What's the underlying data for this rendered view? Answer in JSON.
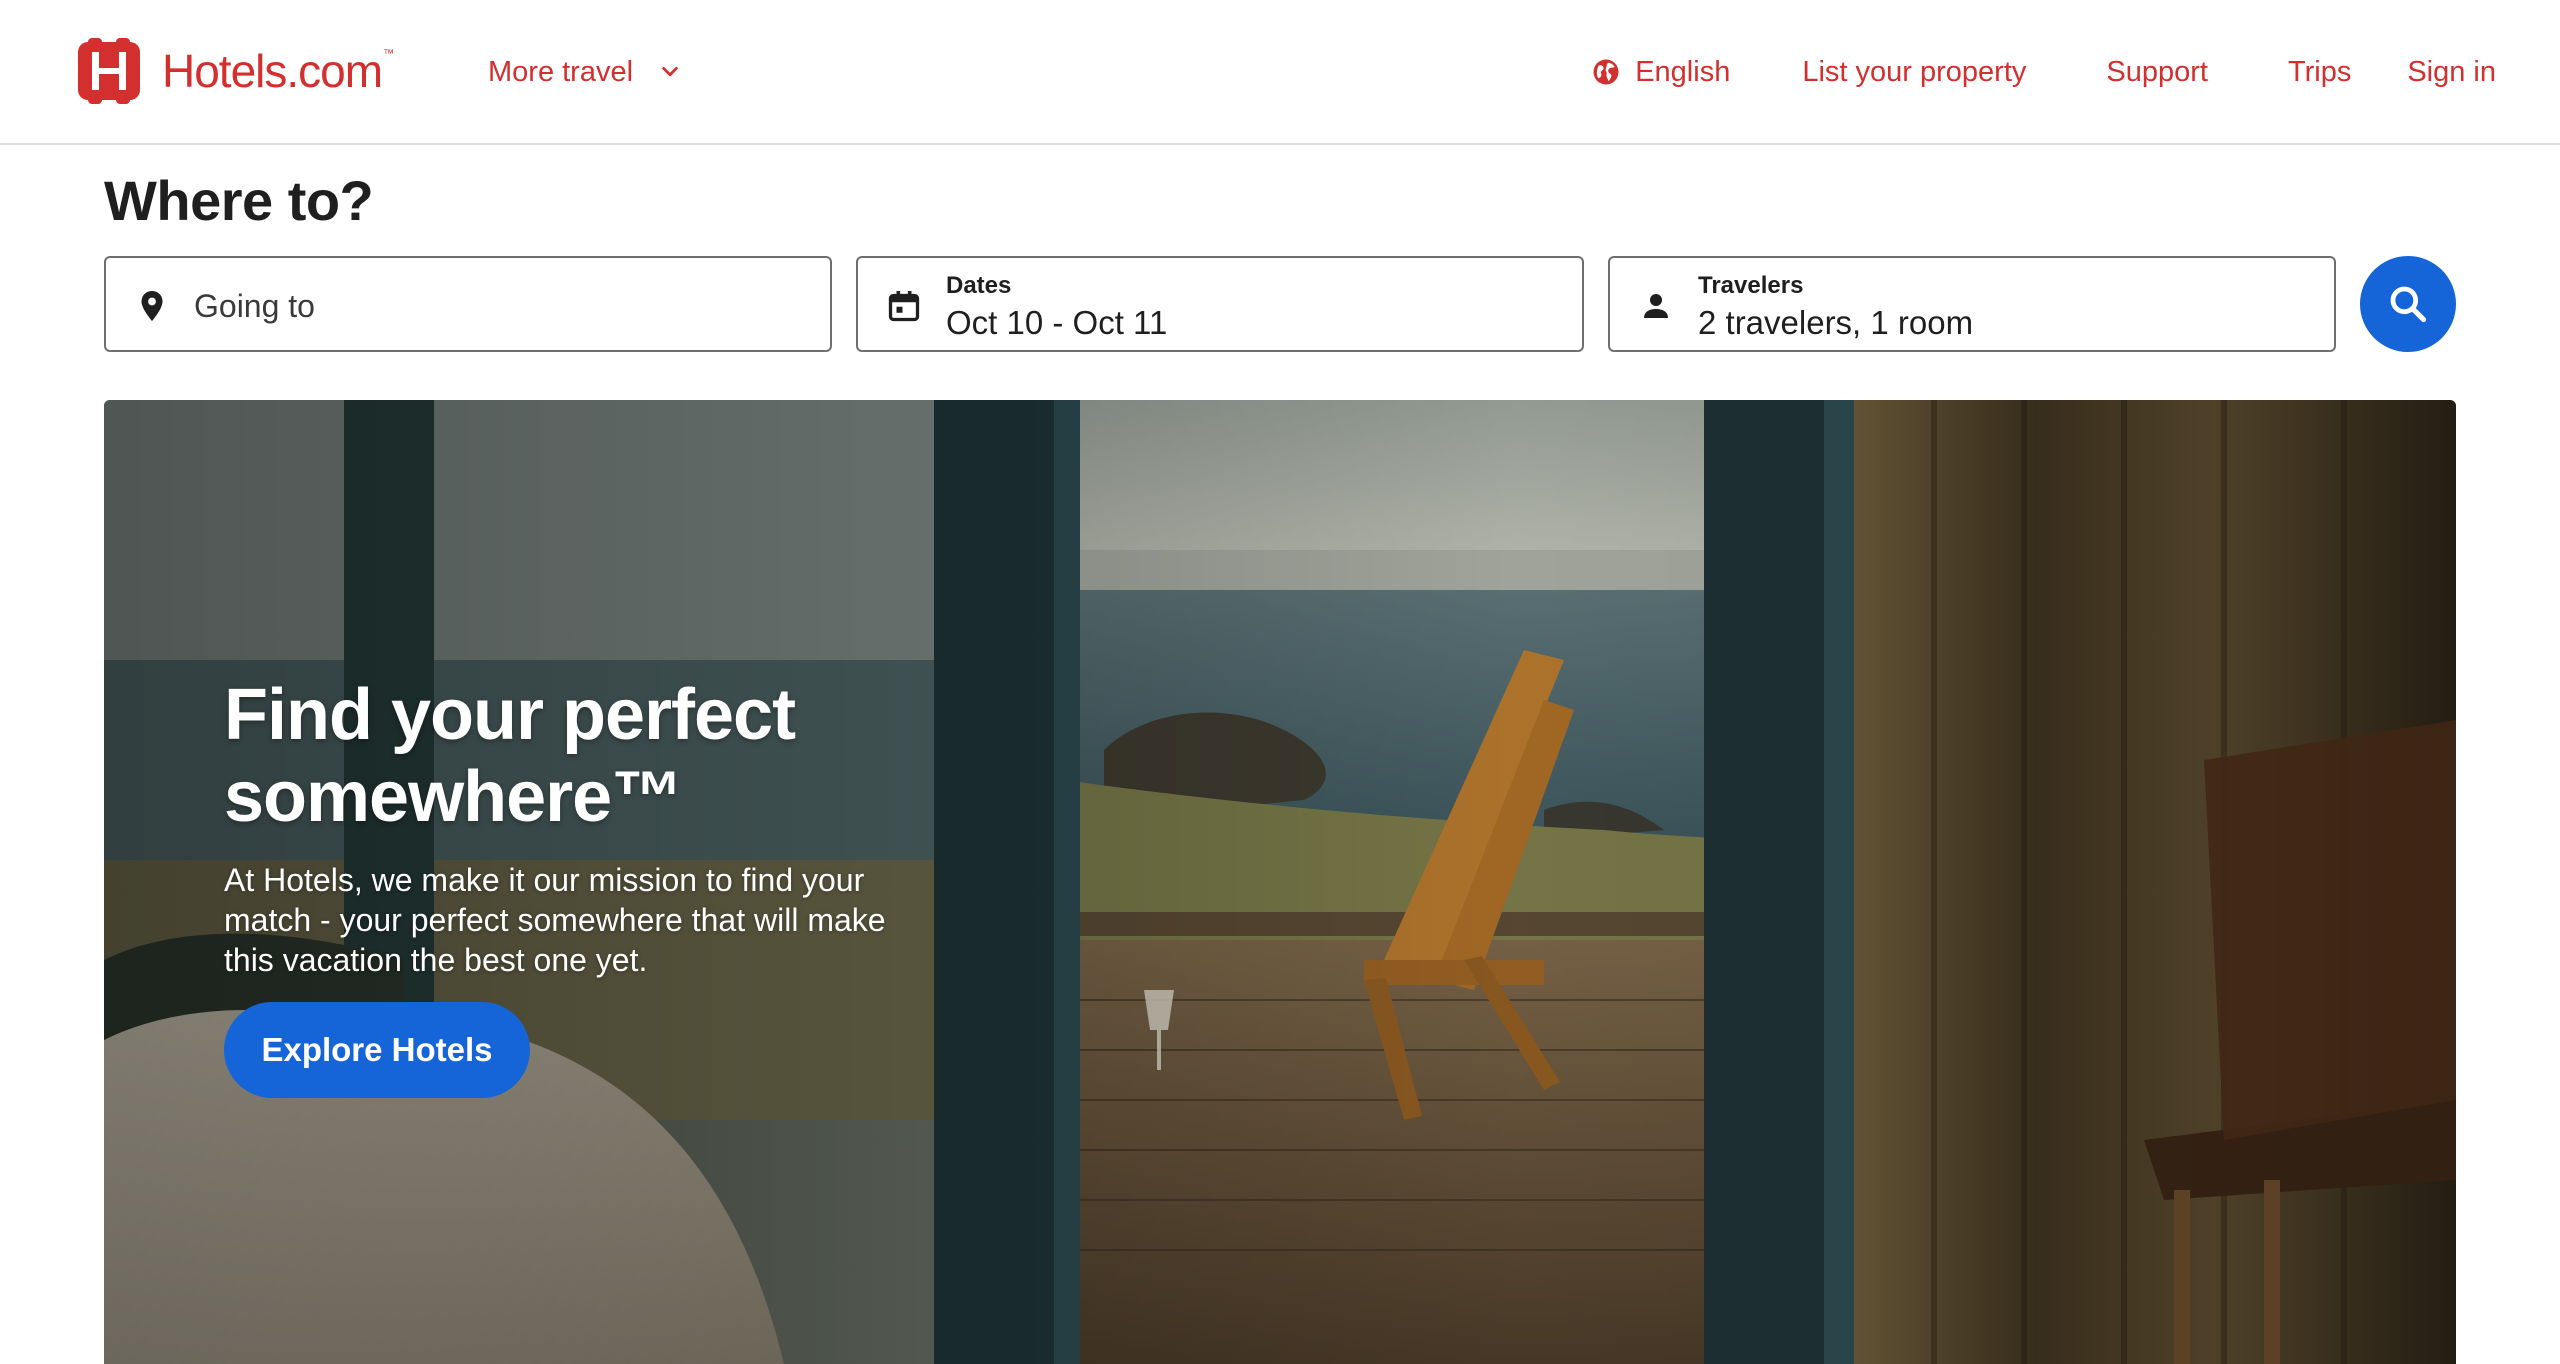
{
  "header": {
    "logo_text": "Hotels.com",
    "logo_tm": "™",
    "more_travel_label": "More travel",
    "nav": {
      "language": "English",
      "list_property": "List your property",
      "support": "Support",
      "trips": "Trips",
      "sign_in": "Sign in"
    }
  },
  "search": {
    "heading": "Where to?",
    "destination": {
      "placeholder": "Going to",
      "icon": "map-pin-icon"
    },
    "dates": {
      "label": "Dates",
      "value": "Oct 10 - Oct 11",
      "icon": "calendar-icon"
    },
    "travelers": {
      "label": "Travelers",
      "value": "2 travelers, 1 room",
      "icon": "person-icon"
    },
    "button_icon": "search-icon"
  },
  "hero": {
    "title": "Find your perfect somewhere™",
    "subtitle": "At Hotels, we make it our mission to find your match - your perfect somewhere that will make this vacation the best one yet.",
    "cta_label": "Explore Hotels"
  },
  "colors": {
    "brand_red": "#d32f2f",
    "primary_blue": "#1565d8",
    "text_dark": "#1f1f1f"
  }
}
